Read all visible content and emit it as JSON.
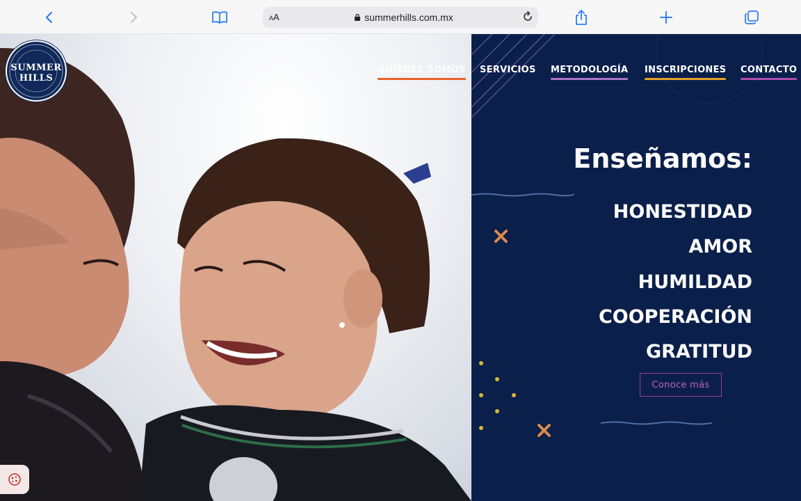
{
  "browser": {
    "url": "summerhills.com.mx",
    "reader_label_small": "A",
    "reader_label_large": "A",
    "icons": [
      "back-icon",
      "forward-icon",
      "bookmarks-icon",
      "lock-icon",
      "reload-icon",
      "share-icon",
      "new-tab-icon",
      "tabs-icon"
    ]
  },
  "logo": {
    "line1": "SUMMER",
    "line2": "HILLS"
  },
  "nav": {
    "items": [
      {
        "label": "QUIÉNES SOMOS",
        "color": "#e8622c"
      },
      {
        "label": "SERVICIOS",
        "color": "#0b1f4b"
      },
      {
        "label": "METODOLOGÍA",
        "color": "#a974c9"
      },
      {
        "label": "INSCRIPCIONES",
        "color": "#e3a12a"
      },
      {
        "label": "CONTACTO",
        "color": "#b14cb1"
      }
    ]
  },
  "hero": {
    "heading": "Enseñamos:",
    "values": [
      "HONESTIDAD",
      "AMOR",
      "HUMILDAD",
      "COOPERACIÓN",
      "GRATITUD"
    ],
    "cta_label": "Conoce más"
  },
  "colors": {
    "navy": "#0b1f4b",
    "accent_orange": "#d98b4a",
    "dot_yellow": "#e3b43a",
    "cta_purple": "#9c3f9c"
  }
}
